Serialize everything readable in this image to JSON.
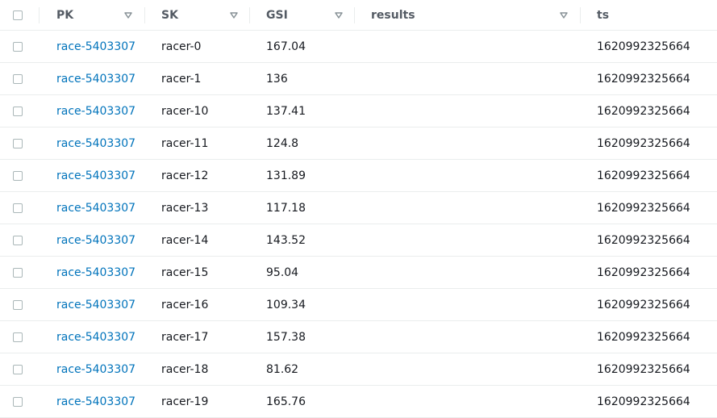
{
  "columns": [
    {
      "key": "pk",
      "label": "PK",
      "sortable": true
    },
    {
      "key": "sk",
      "label": "SK",
      "sortable": true
    },
    {
      "key": "gsi",
      "label": "GSI",
      "sortable": true
    },
    {
      "key": "results",
      "label": "results",
      "sortable": true
    },
    {
      "key": "ts",
      "label": "ts",
      "sortable": false
    }
  ],
  "rows": [
    {
      "pk": "race-5403307",
      "sk": "racer-0",
      "gsi": "167.04",
      "results": "",
      "ts": "1620992325664"
    },
    {
      "pk": "race-5403307",
      "sk": "racer-1",
      "gsi": "136",
      "results": "",
      "ts": "1620992325664"
    },
    {
      "pk": "race-5403307",
      "sk": "racer-10",
      "gsi": "137.41",
      "results": "",
      "ts": "1620992325664"
    },
    {
      "pk": "race-5403307",
      "sk": "racer-11",
      "gsi": "124.8",
      "results": "",
      "ts": "1620992325664"
    },
    {
      "pk": "race-5403307",
      "sk": "racer-12",
      "gsi": "131.89",
      "results": "",
      "ts": "1620992325664"
    },
    {
      "pk": "race-5403307",
      "sk": "racer-13",
      "gsi": "117.18",
      "results": "",
      "ts": "1620992325664"
    },
    {
      "pk": "race-5403307",
      "sk": "racer-14",
      "gsi": "143.52",
      "results": "",
      "ts": "1620992325664"
    },
    {
      "pk": "race-5403307",
      "sk": "racer-15",
      "gsi": "95.04",
      "results": "",
      "ts": "1620992325664"
    },
    {
      "pk": "race-5403307",
      "sk": "racer-16",
      "gsi": "109.34",
      "results": "",
      "ts": "1620992325664"
    },
    {
      "pk": "race-5403307",
      "sk": "racer-17",
      "gsi": "157.38",
      "results": "",
      "ts": "1620992325664"
    },
    {
      "pk": "race-5403307",
      "sk": "racer-18",
      "gsi": "81.62",
      "results": "",
      "ts": "1620992325664"
    },
    {
      "pk": "race-5403307",
      "sk": "racer-19",
      "gsi": "165.76",
      "results": "",
      "ts": "1620992325664"
    }
  ],
  "icons": {
    "sort": "sort-caret-down-icon",
    "checkbox": "checkbox-icon"
  },
  "colors": {
    "link": "#0073bb",
    "header_text": "#545b64",
    "border": "#eaeded"
  }
}
